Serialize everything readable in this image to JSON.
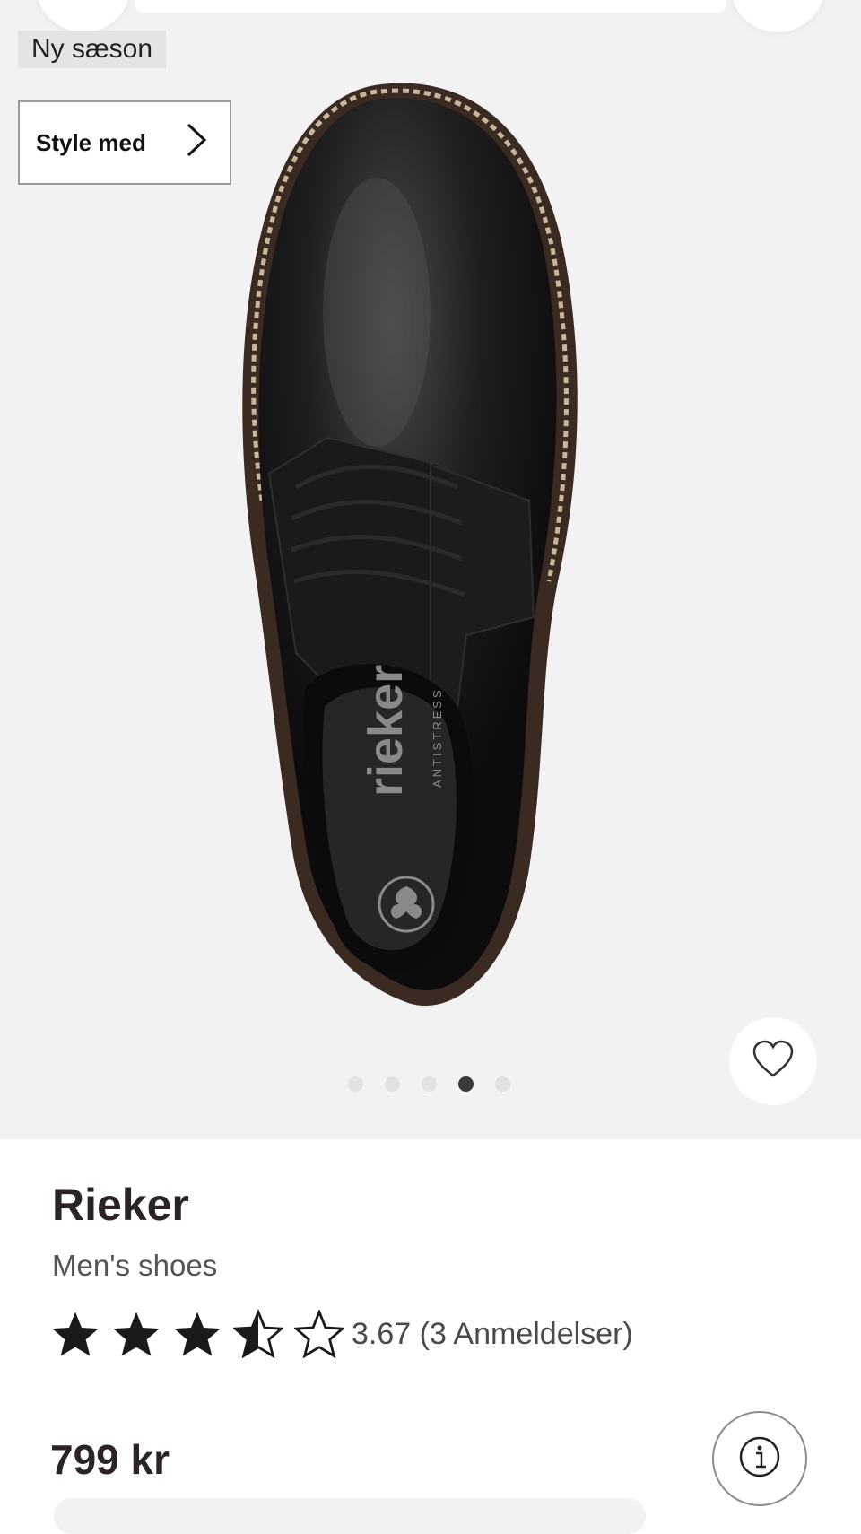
{
  "gallery": {
    "badge": "Ny sæson",
    "style_button": "Style med",
    "image_count": 5,
    "active_image": 4,
    "background": "#f2f2f2",
    "insole_brand": "rieker",
    "insole_subtitle": "ANTISTRESS"
  },
  "product": {
    "brand": "Rieker",
    "category": "Men's shoes",
    "rating": {
      "value": 3.67,
      "text": "3.67 (3 Anmeldelser)",
      "max_stars": 5
    },
    "price": "799 kr"
  },
  "icons": {
    "back": "chevron-left-icon",
    "bag": "shopping-bag-icon",
    "style": "chevron-right-icon",
    "favorite": "heart-icon",
    "info": "info-icon"
  }
}
